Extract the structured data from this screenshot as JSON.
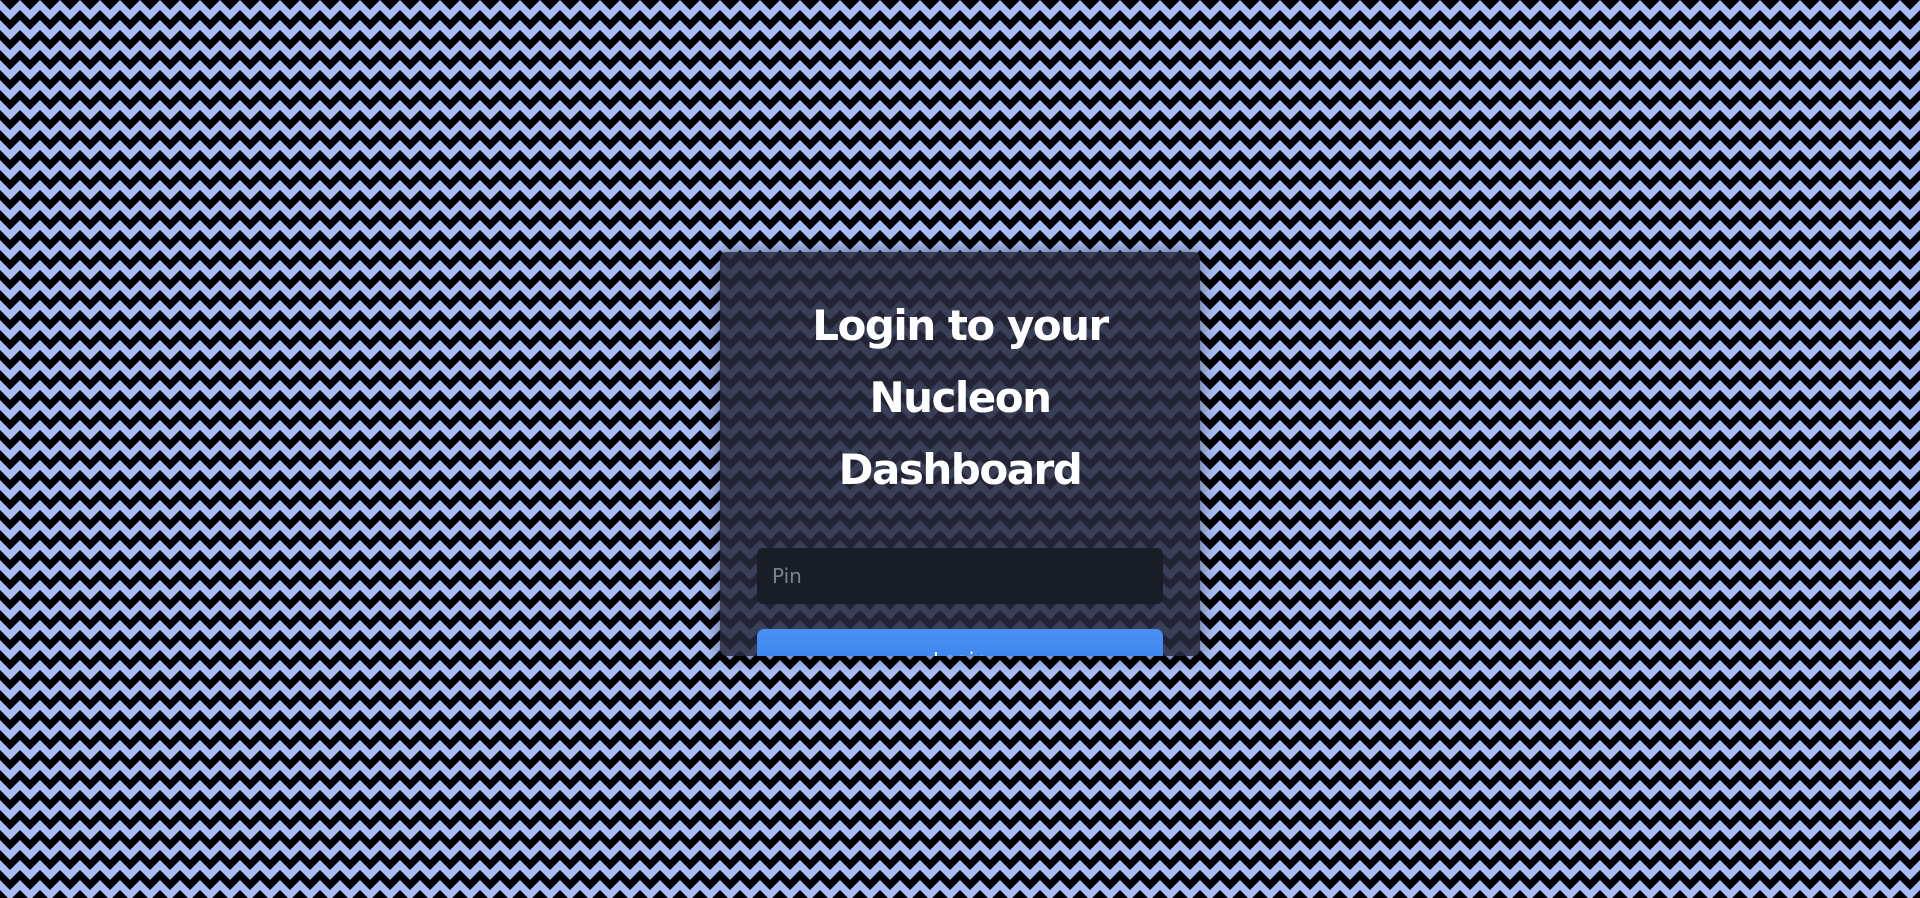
{
  "background": {
    "pattern": "zigzag",
    "colors": {
      "stripe": "#a8bdf6",
      "base": "#000000"
    }
  },
  "login_card": {
    "title_line1": "Login to your",
    "title_line2": "Nucleon Dashboard",
    "pin_input": {
      "value": "",
      "placeholder": "Pin"
    },
    "login_button_label": "Login",
    "colors": {
      "card": "#282a3e",
      "input": "#191d25",
      "button": "#3a84ee"
    }
  }
}
